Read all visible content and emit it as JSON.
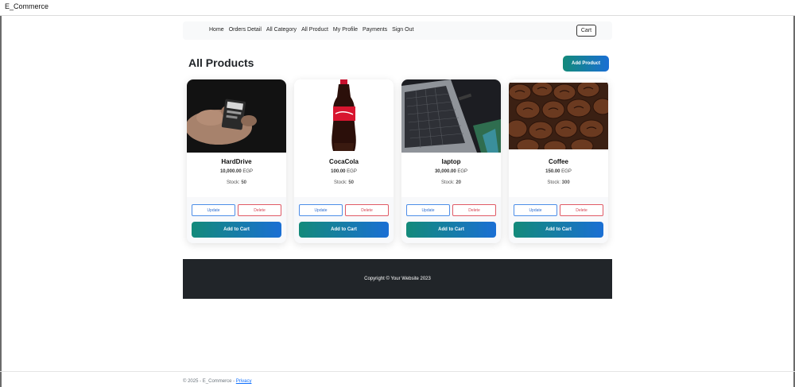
{
  "window": {
    "title": "E_Commerce"
  },
  "nav": {
    "links": [
      "Home",
      "Orders Detail",
      "All Category",
      "All Product",
      "My Profile",
      "Payments",
      "Sign Out"
    ],
    "cart_label": "Cart"
  },
  "main": {
    "title": "All Products",
    "add_button": "Add Product",
    "products": [
      {
        "name": "HardDrive",
        "price": "10,000.00",
        "currency": "EGP",
        "stock_label": "Stock:",
        "stock": "50",
        "update": "Update",
        "delete": "Delete",
        "cart": "Add to Cart",
        "image": "sd-card-photo"
      },
      {
        "name": "CocaCola",
        "price": "100.00",
        "currency": "EGP",
        "stock_label": "Stock:",
        "stock": "50",
        "update": "Update",
        "delete": "Delete",
        "cart": "Add to Cart",
        "image": "cola-bottle-photo"
      },
      {
        "name": "laptop",
        "price": "30,000.00",
        "currency": "EGP",
        "stock_label": "Stock:",
        "stock": "20",
        "update": "Update",
        "delete": "Delete",
        "cart": "Add to Cart",
        "image": "laptop-photo"
      },
      {
        "name": "Coffee",
        "price": "150.00",
        "currency": "EGP",
        "stock_label": "Stock:",
        "stock": "300",
        "update": "Update",
        "delete": "Delete",
        "cart": "Add to Cart",
        "image": "coffee-beans-photo"
      }
    ]
  },
  "footer_dark": {
    "text": "Copyright © Your Website 2023"
  },
  "page_footer": {
    "text": "© 2025 - E_Commerce -",
    "privacy": "Privacy"
  },
  "colors": {
    "gradient_start": "#138a7a",
    "gradient_end": "#1a6fd4",
    "update": "#2f6fd0",
    "delete": "#d43f4f",
    "footer_bg": "#212529"
  }
}
